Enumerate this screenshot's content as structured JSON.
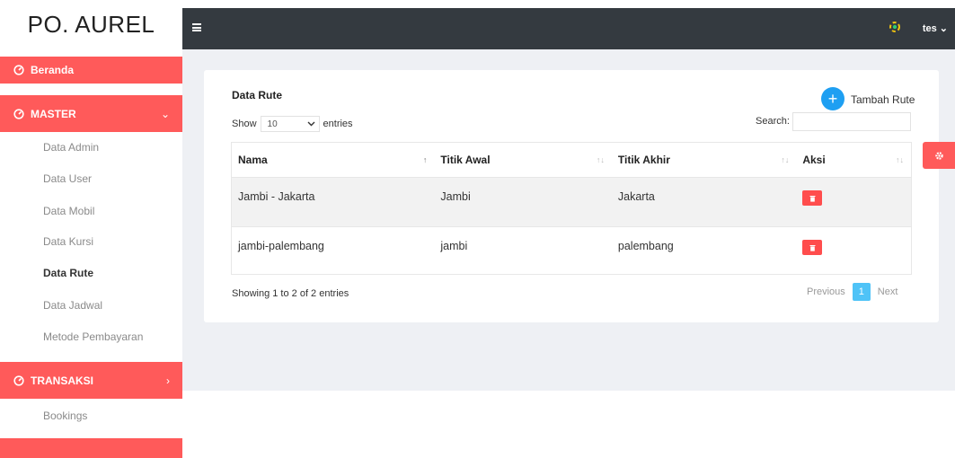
{
  "app": {
    "brand": "PO. AUREL"
  },
  "topbar": {
    "user": "tes",
    "user_chevron": "⌄"
  },
  "sidebar": {
    "beranda": "Beranda",
    "master": "MASTER",
    "master_chevron": "⌄",
    "items": [
      {
        "label": "Data Admin",
        "active": false
      },
      {
        "label": "Data User",
        "active": false
      },
      {
        "label": "Data Mobil",
        "active": false
      },
      {
        "label": "Data Kursi",
        "active": false
      },
      {
        "label": "Data Rute",
        "active": true
      },
      {
        "label": "Data Jadwal",
        "active": false
      },
      {
        "label": "Metode Pembayaran",
        "active": false
      }
    ],
    "transaksi": "TRANSAKSI",
    "transaksi_chevron": "›",
    "transaksi_items": [
      {
        "label": "Bookings"
      }
    ]
  },
  "card": {
    "title": "Data Rute",
    "add_label": "Tambah Rute",
    "add_symbol": "+",
    "show_label": "Show",
    "entries_value": "10",
    "entries_label": "entries",
    "search_label": "Search:",
    "search_value": ""
  },
  "table": {
    "headers": [
      "Nama",
      "Titik Awal",
      "Titik Akhir",
      "Aksi"
    ],
    "rows": [
      [
        "Jambi - Jakarta",
        "Jambi",
        "Jakarta"
      ],
      [
        "jambi-palembang",
        "jambi",
        "palembang"
      ]
    ]
  },
  "footer": {
    "info": "Showing 1 to 2 of 2 entries",
    "previous": "Previous",
    "page": "1",
    "next": "Next"
  },
  "colors": {
    "accent": "#ff5a5a",
    "topbar": "#343a40",
    "primary": "#1e9ff2",
    "page_active": "#4fc3f7"
  }
}
